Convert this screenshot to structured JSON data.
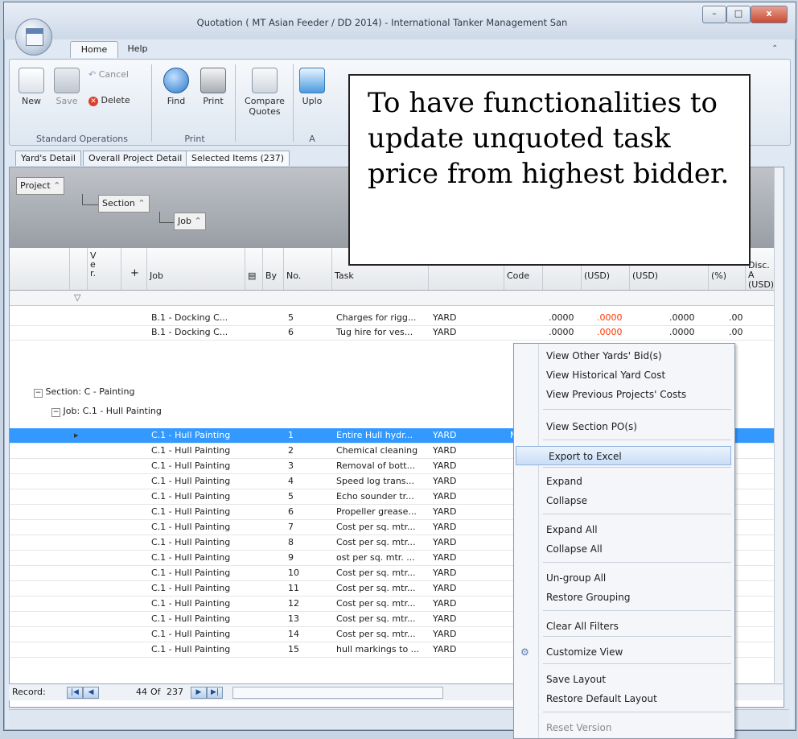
{
  "window": {
    "title": "Quotation ( MT Asian Feeder / DD 2014) - International Tanker Management San",
    "minimize": "–",
    "maximize": "□",
    "close": "x"
  },
  "ribbon_tabs": [
    "Home",
    "Help"
  ],
  "ribbon": {
    "new": "New",
    "save": "Save",
    "cancel": "Cancel",
    "delete": "Delete",
    "find": "Find",
    "print": "Print",
    "compare_quotes": "Compare Quotes",
    "upload": "Uplo",
    "group_standard": "Standard Operations",
    "group_print": "Print",
    "group_a": "A"
  },
  "doc_tabs": [
    "Yard's Detail",
    "Overall Project Detail",
    "Selected Items (237)"
  ],
  "group_panel": [
    "Project",
    "Section",
    "Job"
  ],
  "columns": {
    "ver": "V e r.",
    "plus": "+",
    "job": "Job",
    "by": "By",
    "no": "No.",
    "task": "Task",
    "code": "Code",
    "price": "(USD)",
    "amount": "(USD)",
    "pct": "(%)",
    "disc": "Disc. A (USD)"
  },
  "rows_top": [
    {
      "job": "B.1 - Docking C...",
      "no": "5",
      "task": "Charges for rigg...",
      "cat": "YARD",
      "qty": ".0000",
      "price": ".0000",
      "amount": ".0000",
      "pct": ".00"
    },
    {
      "job": "B.1 - Docking C...",
      "no": "6",
      "task": "Tug hire for ves...",
      "cat": "YARD",
      "qty": ".0000",
      "price": ".0000",
      "amount": ".0000",
      "pct": ".00"
    }
  ],
  "section_label": "Section: C - Painting",
  "job_label": "Job: C.1 - Hull Painting",
  "rows": [
    {
      "job": "C.1 - Hull Painting",
      "no": "1",
      "task": "Entire Hull hydr...",
      "cat": "YARD",
      "code": "M"
    },
    {
      "job": "C.1 - Hull Painting",
      "no": "2",
      "task": "Chemical cleaning",
      "cat": "YARD"
    },
    {
      "job": "C.1 - Hull Painting",
      "no": "3",
      "task": "Removal of bott...",
      "cat": "YARD"
    },
    {
      "job": "C.1 - Hull Painting",
      "no": "4",
      "task": "Speed log trans...",
      "cat": "YARD"
    },
    {
      "job": "C.1 - Hull Painting",
      "no": "5",
      "task": "Echo sounder tr...",
      "cat": "YARD"
    },
    {
      "job": "C.1 - Hull Painting",
      "no": "6",
      "task": "Propeller grease...",
      "cat": "YARD"
    },
    {
      "job": "C.1 - Hull Painting",
      "no": "7",
      "task": "Cost per sq. mtr...",
      "cat": "YARD"
    },
    {
      "job": "C.1 - Hull Painting",
      "no": "8",
      "task": "Cost per sq. mtr...",
      "cat": "YARD"
    },
    {
      "job": "C.1 - Hull Painting",
      "no": "9",
      "task": "ost per sq. mtr. ...",
      "cat": "YARD"
    },
    {
      "job": "C.1 - Hull Painting",
      "no": "10",
      "task": "Cost per sq. mtr...",
      "cat": "YARD"
    },
    {
      "job": "C.1 - Hull Painting",
      "no": "11",
      "task": "Cost per sq. mtr...",
      "cat": "YARD"
    },
    {
      "job": "C.1 - Hull Painting",
      "no": "12",
      "task": "Cost per sq. mtr...",
      "cat": "YARD"
    },
    {
      "job": "C.1 - Hull Painting",
      "no": "13",
      "task": "Cost per sq. mtr...",
      "cat": "YARD"
    },
    {
      "job": "C.1 - Hull Painting",
      "no": "14",
      "task": "Cost per sq. mtr...",
      "cat": "YARD"
    },
    {
      "job": "C.1 - Hull Painting",
      "no": "15",
      "task": "hull markings to ...",
      "cat": "YARD"
    }
  ],
  "nav": {
    "record_label": "Record:",
    "current": "44",
    "of": "Of",
    "total": "237"
  },
  "callout": "To have functionalities to update unquoted task price from highest bidder.",
  "context_menu": [
    "View Other Yards' Bid(s)",
    "View Historical Yard Cost",
    "View Previous Projects' Costs",
    "View Section PO(s)",
    "Export to Excel",
    "Expand",
    "Collapse",
    "Expand All",
    "Collapse All",
    "Un-group All",
    "Restore Grouping",
    "Clear All Filters",
    "Customize View",
    "Save Layout",
    "Restore Default Layout",
    "Reset Version"
  ],
  "colors": {
    "accent": "#3399ff",
    "price_red": "#ff3300"
  }
}
